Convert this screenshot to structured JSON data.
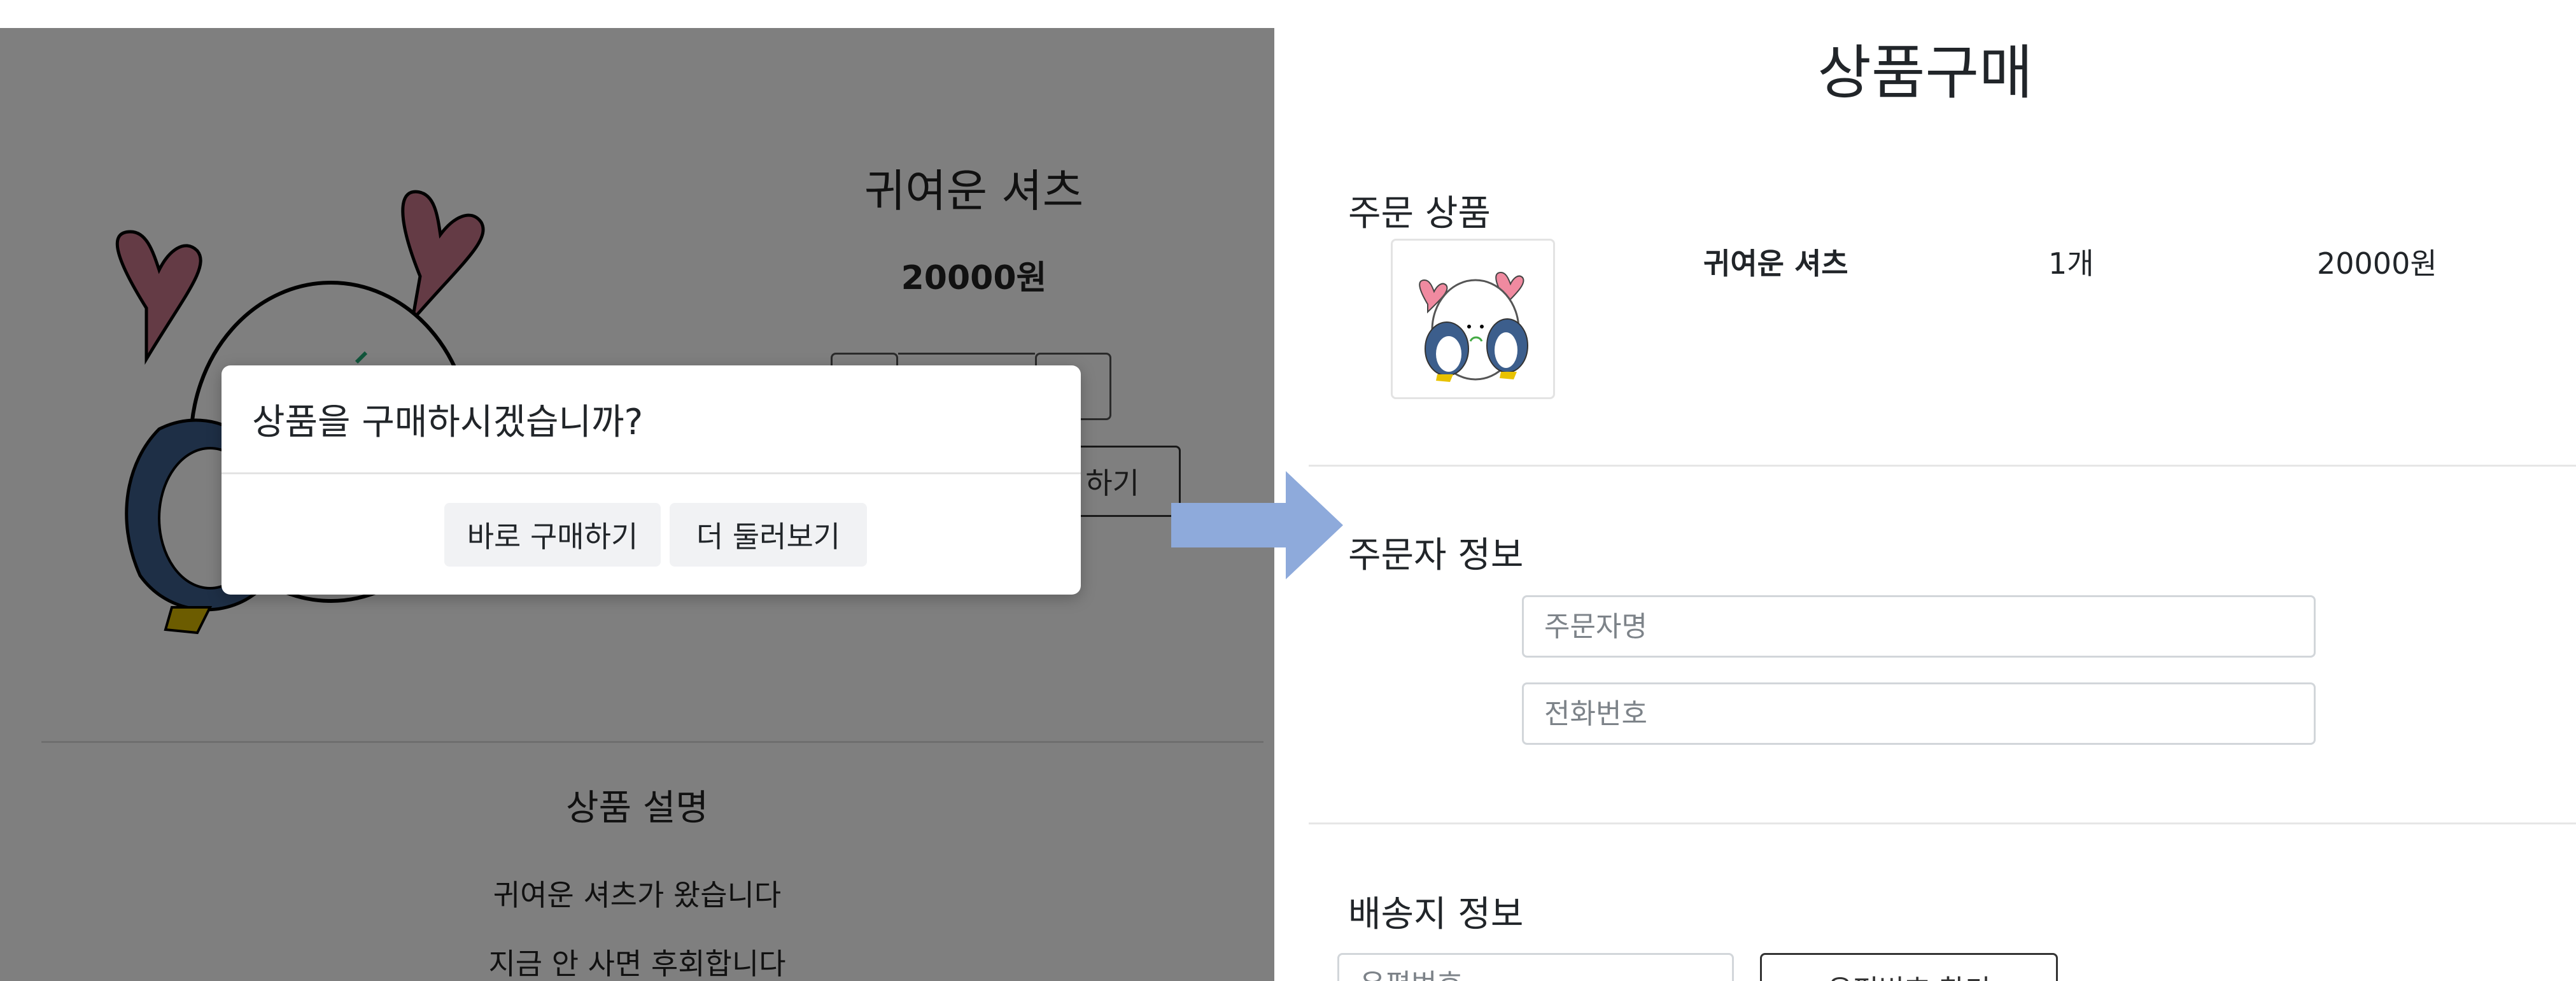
{
  "product_page": {
    "title": "귀여운 셔츠",
    "price": "20000원",
    "buy_button_label": "하기",
    "description_title": "상품 설명",
    "description_lines": [
      "귀여운 셔츠가 왔습니다",
      "지금 안 사면 후회합니다"
    ]
  },
  "modal": {
    "question": "상품을 구매하시겠습니까?",
    "buy_now_label": "바로 구매하기",
    "browse_more_label": "더 둘러보기"
  },
  "order_page": {
    "title": "상품구매",
    "items_section_title": "주문 상품",
    "item": {
      "name": "귀여운 셔츠",
      "quantity": "1개",
      "price": "20000원"
    },
    "orderer_section_title": "주문자 정보",
    "orderer_name_placeholder": "주문자명",
    "phone_placeholder": "전화번호",
    "shipping_section_title": "배송지 정보",
    "postcode_placeholder": "우편번호",
    "find_postcode_label": "우편번호 찾기"
  },
  "colors": {
    "overlay": "#808080",
    "arrow": "#8eaadb",
    "heart": "#c9778a",
    "penguin_dark": "#3c5e8c"
  },
  "icons": {
    "illustration": "penguin-heart-illustration",
    "arrow": "right-arrow-icon"
  }
}
